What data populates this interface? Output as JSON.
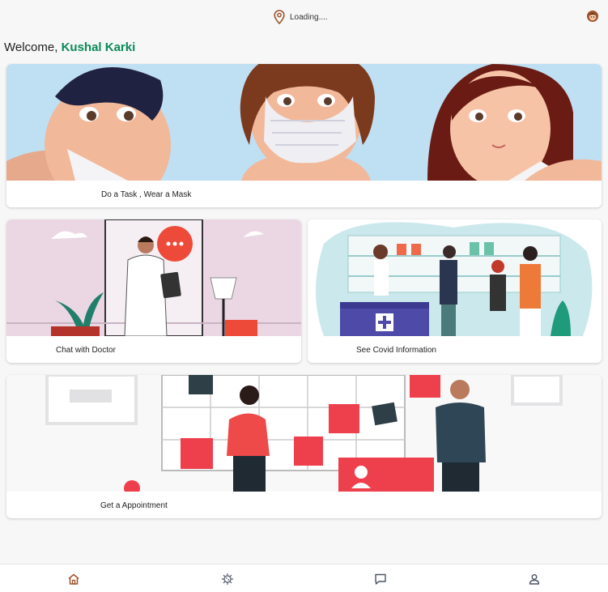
{
  "header": {
    "location_text": "Loading...."
  },
  "welcome": {
    "prefix": "Welcome, ",
    "user_name": "Kushal Karki"
  },
  "cards": {
    "mask": {
      "label": "Do a Task , Wear a Mask"
    },
    "doctor": {
      "label": "Chat with Doctor"
    },
    "covid": {
      "label": "See Covid Information"
    },
    "appointment": {
      "label": "Get a Appointment"
    }
  },
  "nav": {
    "items": [
      {
        "icon": "home-icon",
        "active": true
      },
      {
        "icon": "virus-icon"
      },
      {
        "icon": "chat-icon"
      },
      {
        "icon": "profile-icon"
      }
    ]
  },
  "colors": {
    "accent": "#a0522d",
    "user_name": "#0a8a5a"
  }
}
